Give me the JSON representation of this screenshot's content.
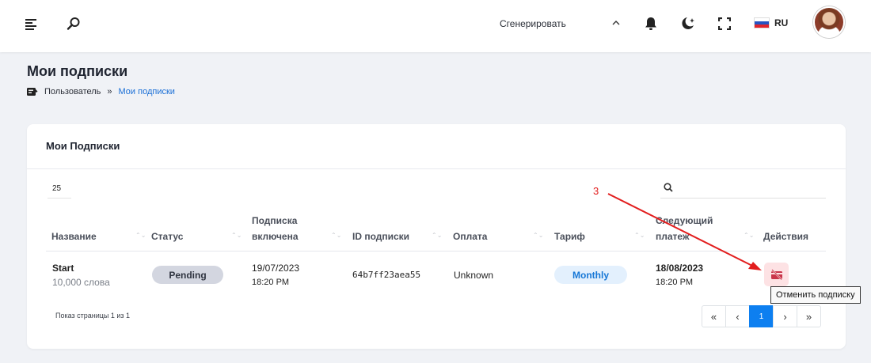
{
  "header": {
    "generate_label": "Сгенерировать",
    "language": "RU"
  },
  "page": {
    "title": "Мои подписки",
    "breadcrumb": {
      "parent": "Пользователь",
      "separator": "»",
      "current": "Мои подписки"
    }
  },
  "card": {
    "title": "Мои Подписки",
    "page_size": "25",
    "search": {
      "value": "",
      "placeholder": ""
    }
  },
  "table": {
    "columns": {
      "name": "Название",
      "status": "Статус",
      "enabled_line1": "Подписка",
      "enabled_line2": "включена",
      "sub_id": "ID подписки",
      "payment": "Оплата",
      "tariff": "Тариф",
      "next_line1": "Следующий",
      "next_line2": "платеж",
      "actions": "Действия"
    },
    "rows": [
      {
        "name": "Start",
        "words": "10,000 слова",
        "status": "Pending",
        "enabled_date": "19/07/2023",
        "enabled_time": "18:20 PM",
        "sub_id": "64b7ff23aea55",
        "payment": "Unknown",
        "tariff": "Monthly",
        "next_date": "18/08/2023",
        "next_time": "18:20 PM",
        "cancel_tooltip": "Отменить подписку"
      }
    ]
  },
  "footer": {
    "page_info": "Показ страницы 1 из 1",
    "pager": {
      "first": "«",
      "prev": "‹",
      "current": "1",
      "next": "›",
      "last": "»"
    }
  },
  "annotation": {
    "label": "3",
    "color": "#e21d1d"
  },
  "colors": {
    "accent": "#0d7ff0",
    "pending_bg": "#d3d6e0",
    "monthly_bg": "#e3f0fd",
    "cancel_bg": "#fde2e4",
    "cancel_icon": "#c9354a"
  },
  "icons": [
    "menu-icon",
    "search-icon",
    "chevron-up-icon",
    "bell-icon",
    "theme-toggle-icon",
    "fullscreen-icon",
    "flag-ru-icon",
    "breadcrumb-icon",
    "sort-icon",
    "card-cancel-icon"
  ]
}
